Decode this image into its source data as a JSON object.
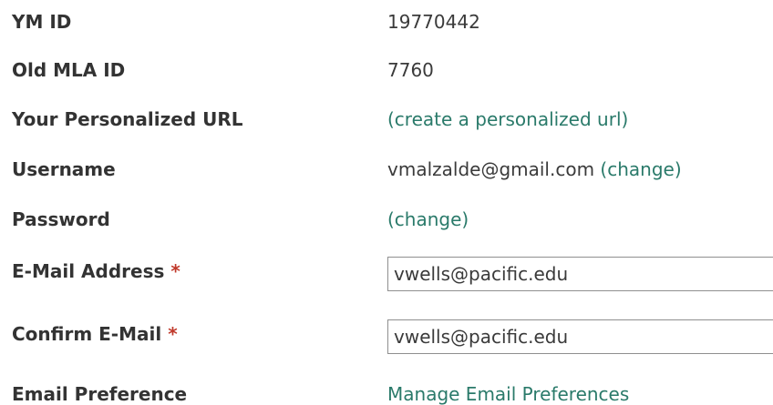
{
  "fields": {
    "ym_id": {
      "label": "YM ID",
      "value": "19770442"
    },
    "old_mla_id": {
      "label": "Old MLA ID",
      "value": "7760"
    },
    "personalized_url": {
      "label": "Your Personalized URL",
      "link": "(create a personalized url)"
    },
    "username": {
      "label": "Username",
      "value": "vmalzalde@gmail.com",
      "change_link": "(change)"
    },
    "password": {
      "label": "Password",
      "change_link": "(change)"
    },
    "email": {
      "label": "E-Mail Address",
      "required_mark": "*",
      "value": "vwells@pacific.edu"
    },
    "confirm_email": {
      "label": "Confirm E-Mail",
      "required_mark": "*",
      "value": "vwells@pacific.edu"
    },
    "email_preference": {
      "label": "Email Preference",
      "link": "Manage Email Preferences"
    }
  },
  "colors": {
    "link": "#2a7a6a",
    "required": "#c0392b",
    "label": "#333333"
  }
}
